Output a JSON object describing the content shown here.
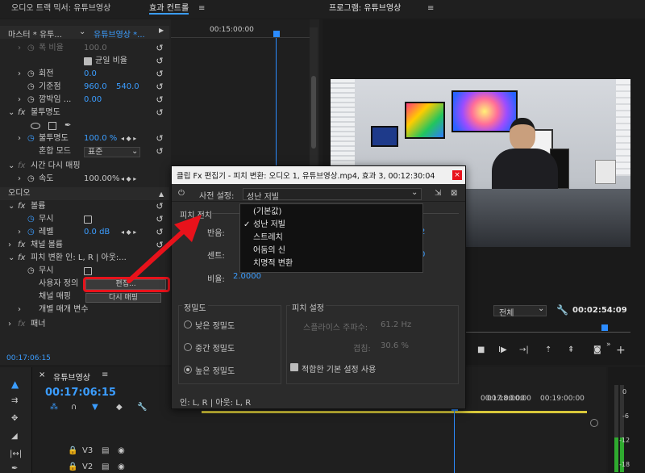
{
  "tabs": {
    "audio_mixer": "오디오 트랙 믹서: 유튜브영상",
    "effect_controls": "효과 컨트롤",
    "program": "프로그램: 유튜브영상"
  },
  "effect_controls": {
    "master_label": "마스터 * 유투...",
    "clip_label": "유튜브영상 *...",
    "ruler_time": "00:15:00:00",
    "rows": {
      "width_label": "폭 비율",
      "width_value": "100.0",
      "uniform_label": "균일 비율",
      "rotation_label": "회전",
      "rotation_value": "0.0",
      "anchor_label": "기준점",
      "anchor_x": "960.0",
      "anchor_y": "540.0",
      "flicker_label": "깜박임 ...",
      "flicker_value": "0.00",
      "opacity_section": "불투명도",
      "opacity_label": "불투명도",
      "opacity_value": "100.0 %",
      "blend_label": "혼합 모드",
      "blend_value": "표준",
      "time_remap": "시간 다시 매핑",
      "speed_label": "속도",
      "speed_value": "100.00%",
      "audio_header": "오디오",
      "volume_section": "볼륨",
      "bypass_label": "무시",
      "level_label": "레벨",
      "level_value": "0.0 dB",
      "channel_volume": "채널 볼륨",
      "pitch_shift": "피치 변환 인: L, R | 아웃:...",
      "bypass2_label": "무시",
      "custom_setup_label": "사용자 정의",
      "edit_button": "편집...",
      "channel_map_label": "채널 매핑",
      "remap_button": "다시 매핑",
      "individual_params": "개별 매개 변수",
      "panner": "패너"
    },
    "bottom_time": "00:17:06:15"
  },
  "program": {
    "fit_value": "전체",
    "duration": "00:02:54:09"
  },
  "timeline": {
    "sequence_name": "유튜브영상",
    "timecode": "00:17:06:15",
    "ruler": [
      "00:17:00:00",
      "00:18:00:00",
      "00:19:00:00"
    ],
    "tracks": [
      "V3",
      "V2"
    ]
  },
  "audio_meter": {
    "labels": [
      "0",
      "-6",
      "-12",
      "-18"
    ]
  },
  "dialog": {
    "title": "클립 Fx 편집기 - 피치 변환: 오디오 1, 유튜브영상.mp4, 효과 3, 00:12:30:04",
    "preset_label": "사전 설정:",
    "preset_value": "성난 저빌",
    "pitch_section": "피치 전치",
    "semitones_label": "반음:",
    "cents_label": "센트:",
    "ratio_label": "비율:",
    "ratio_value": "2.0000",
    "right_value_1": "2",
    "right_value_2": "0",
    "precision_section": "정밀도",
    "precision_low": "낮은 정밀도",
    "precision_mid": "중간 정밀도",
    "precision_high": "높은 정밀도",
    "pitch_settings_section": "피치 설정",
    "splice_label": "스플라이스 주파수:",
    "splice_value": "61.2 Hz",
    "overlap_label": "겹침:",
    "overlap_value": "30.6 %",
    "default_settings": "적합한 기본 설정 사용",
    "footer": "인: L, R | 아웃: L, R",
    "dropdown": [
      "(기본값)",
      "성난 저빌",
      "스트레치",
      "어둠의 신",
      "치명적 변환"
    ]
  },
  "colors": {
    "accent_blue": "#3b9dff",
    "highlight_red": "#e8121b",
    "playhead": "#2c8cff"
  }
}
